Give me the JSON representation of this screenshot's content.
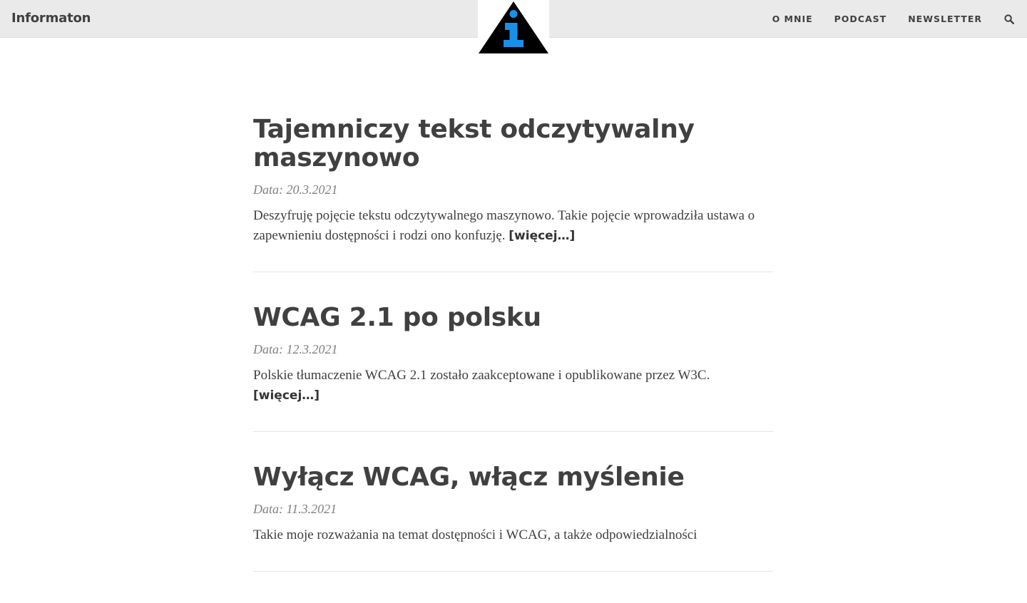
{
  "navbar": {
    "brand": "Informaton",
    "logo_icon": "info-triangle-icon",
    "links": [
      "O MNIE",
      "PODCAST",
      "NEWSLETTER"
    ],
    "search_icon": "search-icon",
    "background": "#eaeaea"
  },
  "posts": [
    {
      "title": "Tajemniczy tekst odczytywalny maszynowo",
      "date": "Data: 20.3.2021",
      "excerpt": "Deszyfruję pojęcie tekstu odczytywalnego maszynowo. Takie pojęcie wprowadziła ustawa o zapewnieniu dostępności i rodzi ono konfuzję.",
      "more": "[więcej…]"
    },
    {
      "title": "WCAG 2.1 po polsku",
      "date": "Data: 12.3.2021",
      "excerpt": "Polskie tłumaczenie WCAG 2.1 zostało zaakceptowane i opublikowane przez W3C.",
      "more": "[więcej…]"
    },
    {
      "title": "Wyłącz WCAG, włącz myślenie",
      "date": "Data: 11.3.2021",
      "excerpt": "Takie moje rozważania na temat dostępności i WCAG, a także odpowiedzialności",
      "more": ""
    }
  ],
  "colors": {
    "text": "#404040",
    "meta": "#808080",
    "logo_blue": "#1a8fe8",
    "logo_black": "#000000"
  }
}
